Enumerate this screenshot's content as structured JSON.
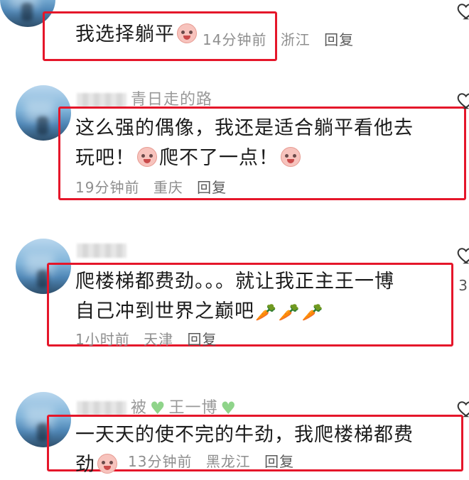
{
  "comments": [
    {
      "text_parts": [
        "我选择躺平"
      ],
      "time": "14分钟前",
      "location": "浙江",
      "reply": "回复"
    },
    {
      "username_visible": "青日走的路",
      "line1": "这么强的偶像，我还是适合躺平看他去",
      "line2_a": "玩吧！",
      "line2_b": "爬不了一点！",
      "time": "19分钟前",
      "location": "重庆",
      "reply": "回复"
    },
    {
      "line1": "爬楼梯都费劲。。。就让我正主王一博",
      "line2": "自己冲到世界之巅吧",
      "time": "1小时前",
      "location": "天津",
      "reply": "回复",
      "side_count": "3"
    },
    {
      "username_visible_a": "被",
      "username_visible_b": "王一博",
      "line1": "一天天的使不完的牛劲，我爬楼梯都费",
      "line2": "劲",
      "time": "13分钟前",
      "location": "黑龙江",
      "reply": "回复"
    }
  ],
  "colors": {
    "highlight_box": "#e5162a",
    "meta_text": "#8e8e8e",
    "heart": "#8fd48a"
  },
  "icons": [
    "heart-outline-icon",
    "cry-laugh-emoji",
    "carrot-emoji",
    "green-heart-icon"
  ]
}
